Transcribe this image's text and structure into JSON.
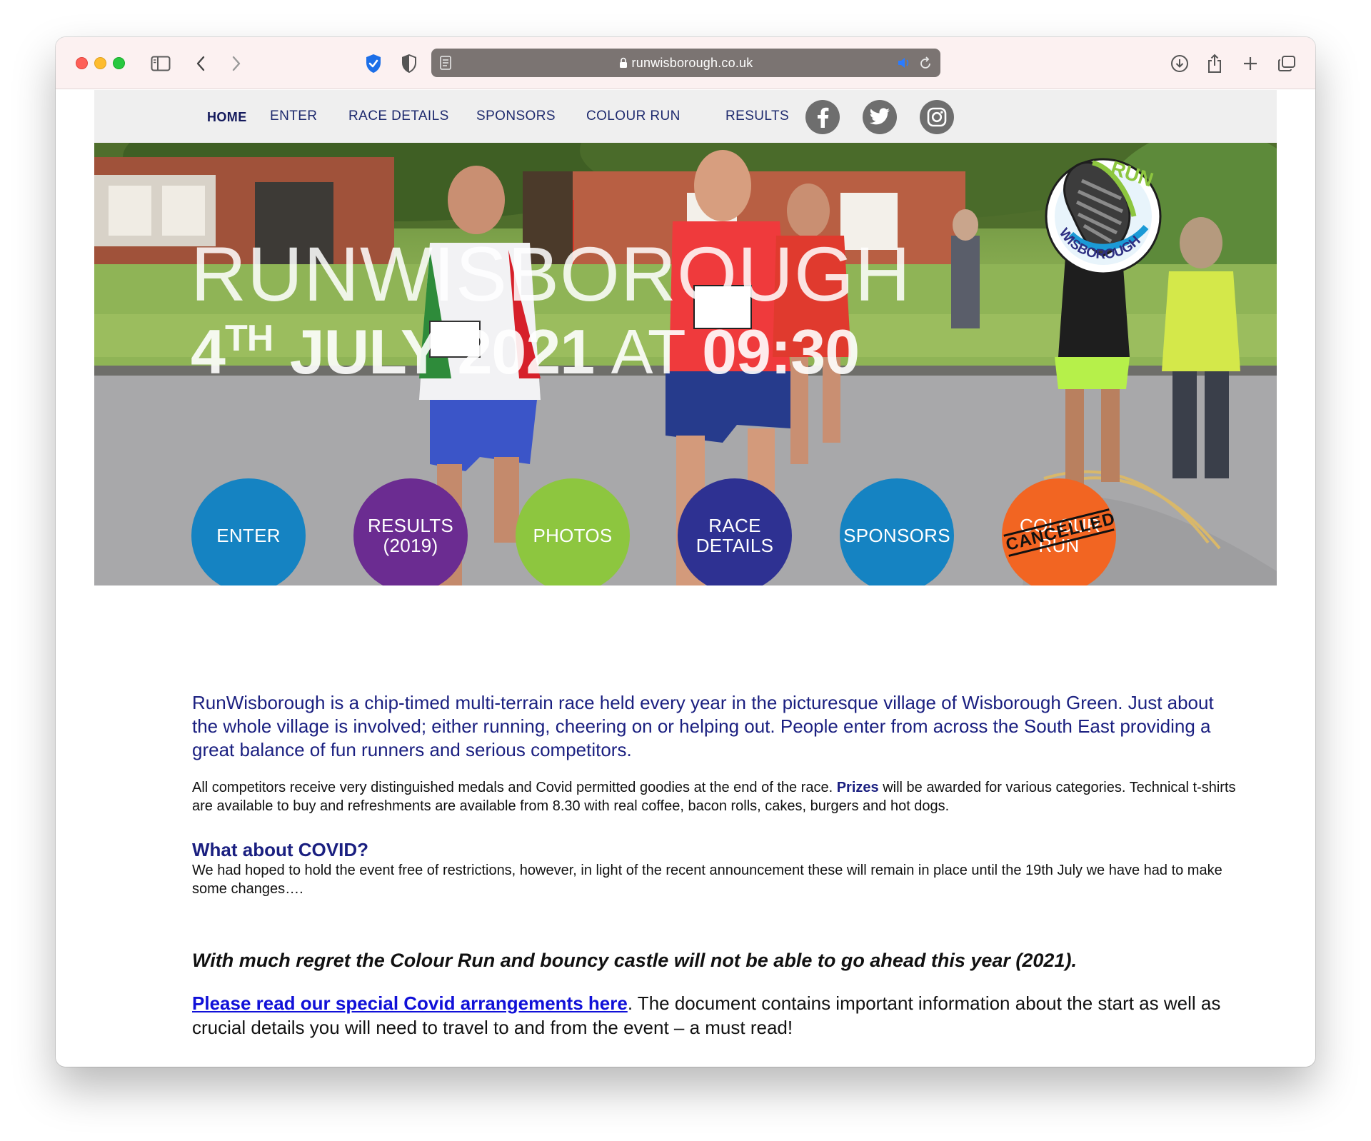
{
  "browser": {
    "url": "runwisborough.co.uk"
  },
  "nav": {
    "items": [
      "HOME",
      "ENTER",
      "RACE DETAILS",
      "SPONSORS",
      "COLOUR RUN",
      "RESULTS"
    ],
    "social": [
      "facebook-icon",
      "twitter-icon",
      "instagram-icon"
    ]
  },
  "logo": {
    "text_top": "RUN",
    "text_bottom": "WISBOROUGH"
  },
  "hero": {
    "title": "RUNWISBOROUGH",
    "date_day": "4",
    "date_suffix": "TH",
    "date_rest": "JULY 2021",
    "date_at": "AT",
    "date_time": "09:30",
    "circles": [
      {
        "label": "ENTER",
        "color": "#1583c2"
      },
      {
        "label": "RESULTS (2019)",
        "color": "#6b2c91"
      },
      {
        "label": "PHOTOS",
        "color": "#8dc63f"
      },
      {
        "label": "RACE DETAILS",
        "color": "#2e3192"
      },
      {
        "label": "SPONSORS",
        "color": "#1583c2"
      },
      {
        "label": "COLOUR RUN",
        "color": "#f26522",
        "stamp": "CANCELLED"
      }
    ]
  },
  "content": {
    "intro": "RunWisborough is a chip-timed multi-terrain race held every year in the picturesque village of Wisborough Green. Just about the whole village is involved; either running, cheering on or helping out. People enter from across the South East providing a great balance of fun runners and serious competitors.",
    "para1_a": "All competitors receive very distinguished medals and Covid permitted goodies at the end of the race.",
    "para1_prizes": "Prizes",
    "para1_b": "will be awarded for various categories. Technical t-shirts are available to buy and refreshments are available from 8.30 with real coffee, bacon rolls, cakes, burgers and hot dogs.",
    "covid_heading": "What about COVID?",
    "covid_text": "We had hoped to hold the event free of restrictions, however, in light of the recent announcement these will remain in place until the 19th July we have had to make some changes….",
    "regret": "With much regret the Colour Run and bouncy castle will not be able to go ahead this year (2021).",
    "covid_link": "Please read our special Covid arrangements here",
    "covid_link_after": ". The document contains important information about the start as well as crucial details you will need to travel to and from the event – a must read!"
  },
  "colors": {
    "nav_text": "#1e2a6e",
    "heading_blue": "#1a1f80",
    "link_blue": "#1010d8"
  }
}
